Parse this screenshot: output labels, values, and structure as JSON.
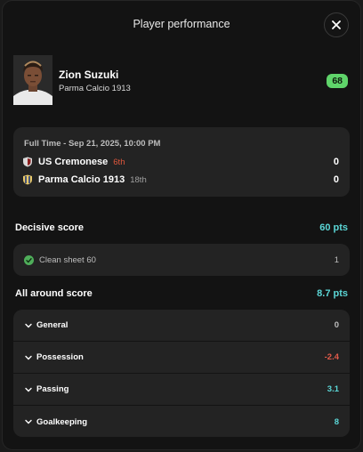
{
  "header": {
    "title": "Player performance"
  },
  "player": {
    "name": "Zion Suzuki",
    "team": "Parma Calcio 1913",
    "rating": "68"
  },
  "match": {
    "status": "Full Time - Sep 21, 2025, 10:00 PM",
    "teams": [
      {
        "name": "US Cremonese",
        "position": "6th",
        "position_color": "#e0573c",
        "score": "0",
        "shield_color": "#d9d9d9"
      },
      {
        "name": "Parma Calcio 1913",
        "position": "18th",
        "position_color": "#a0a0a0",
        "score": "0",
        "shield_color": "#e9c96a"
      }
    ]
  },
  "decisive": {
    "title": "Decisive score",
    "points": "60 pts",
    "item_label": "Clean sheet 60",
    "item_value": "1",
    "item_icon": "shield-check-icon"
  },
  "all_around": {
    "title": "All around score",
    "points": "8.7 pts",
    "rows": [
      {
        "label": "General",
        "value": "0",
        "color": "#bdbdbd"
      },
      {
        "label": "Possession",
        "value": "-2.4",
        "color": "#e25a4a"
      },
      {
        "label": "Passing",
        "value": "3.1",
        "color": "#5bd6d6"
      },
      {
        "label": "Goalkeeping",
        "value": "8",
        "color": "#5bd6d6"
      }
    ]
  },
  "colors": {
    "accent": "#5bd6d6",
    "rating_bg": "#5fd46a",
    "negative": "#e25a4a"
  }
}
